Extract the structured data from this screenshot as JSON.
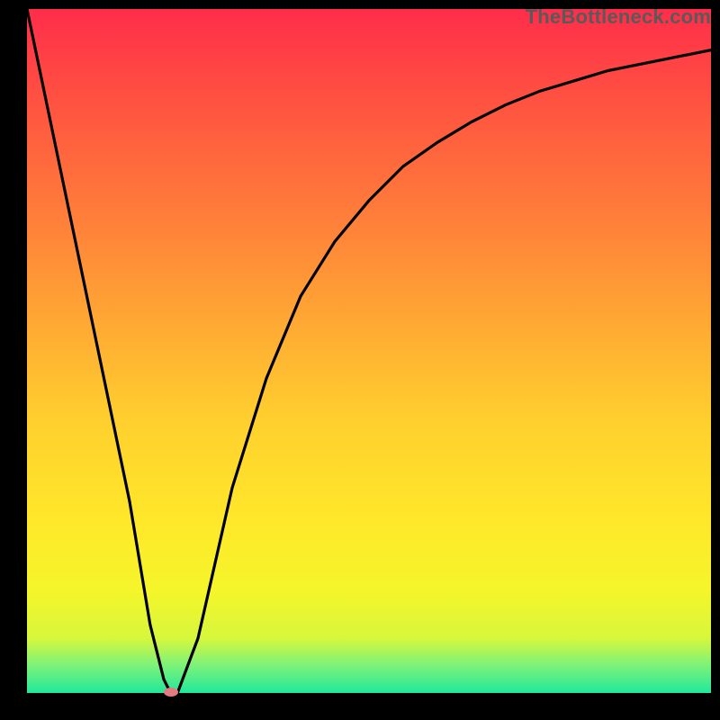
{
  "watermark": "TheBottleneck.com",
  "chart_data": {
    "type": "line",
    "title": "",
    "xlabel": "",
    "ylabel": "",
    "xlim": [
      0,
      100
    ],
    "ylim": [
      0,
      100
    ],
    "grid": false,
    "legend": false,
    "series": [
      {
        "name": "curve",
        "x": [
          0,
          5,
          10,
          15,
          18,
          20,
          21,
          22,
          25,
          30,
          35,
          40,
          45,
          50,
          55,
          60,
          65,
          70,
          75,
          80,
          85,
          90,
          95,
          100
        ],
        "y": [
          100,
          76,
          52,
          28,
          10,
          2,
          0,
          0,
          8,
          30,
          46,
          58,
          66,
          72,
          77,
          80.5,
          83.5,
          86,
          88,
          89.5,
          91,
          92,
          93,
          94
        ]
      }
    ],
    "marker": {
      "x": 21,
      "y": 0,
      "color": "#e37b80"
    },
    "gradient_stops": [
      {
        "pct": 0,
        "color": "#ff2d4a"
      },
      {
        "pct": 15,
        "color": "#ff5640"
      },
      {
        "pct": 30,
        "color": "#ff7d3a"
      },
      {
        "pct": 45,
        "color": "#ffa634"
      },
      {
        "pct": 60,
        "color": "#ffcf2e"
      },
      {
        "pct": 75,
        "color": "#ffe82a"
      },
      {
        "pct": 85,
        "color": "#f5f52a"
      },
      {
        "pct": 92,
        "color": "#d7f73c"
      },
      {
        "pct": 96,
        "color": "#7cf27a"
      },
      {
        "pct": 100,
        "color": "#21e89a"
      }
    ]
  }
}
